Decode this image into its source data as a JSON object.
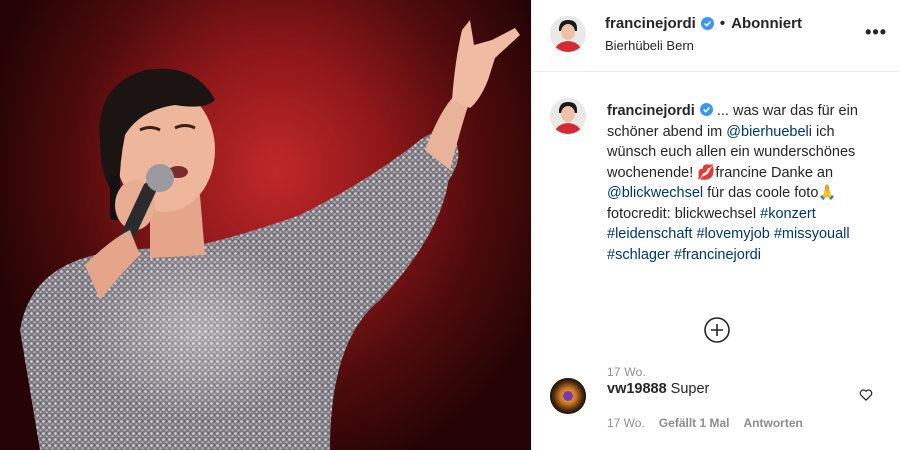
{
  "post": {
    "username": "francinejordi",
    "follow_dot": "•",
    "follow_status": "Abonniert",
    "location": "Bierhübeli Bern",
    "more_icon": "•••"
  },
  "caption": {
    "username": "francinejordi",
    "text_1": " ... was war das für ein schöner abend im ",
    "mention_1": "@bierhuebeli",
    "text_2": " ich wünsch euch allen ein wunderschönes wochenende! ",
    "emoji_lips": "💋",
    "text_3": "francine Danke an ",
    "mention_2": "@blickwechsel",
    "text_4": " für das coole foto",
    "emoji_pray": "🙏",
    "text_5": " fotocredit: blickwechsel ",
    "hashtags": [
      "#konzert",
      "#leidenschaft",
      "#lovemyjob",
      "#missyouall",
      "#schlager",
      "#francinejordi"
    ],
    "age": "17 Wo."
  },
  "comment": {
    "username": "vw19888",
    "text": "Super",
    "age": "17 Wo.",
    "likes": "Gefällt 1 Mal",
    "reply": "Antworten"
  },
  "colors": {
    "link": "#00376b",
    "verified": "#3897f0",
    "muted": "#8e8e8e",
    "stage_red": "#8e1719"
  },
  "icons": [
    "verified-badge-icon",
    "more-options-icon",
    "load-more-comments-icon",
    "heart-icon"
  ]
}
